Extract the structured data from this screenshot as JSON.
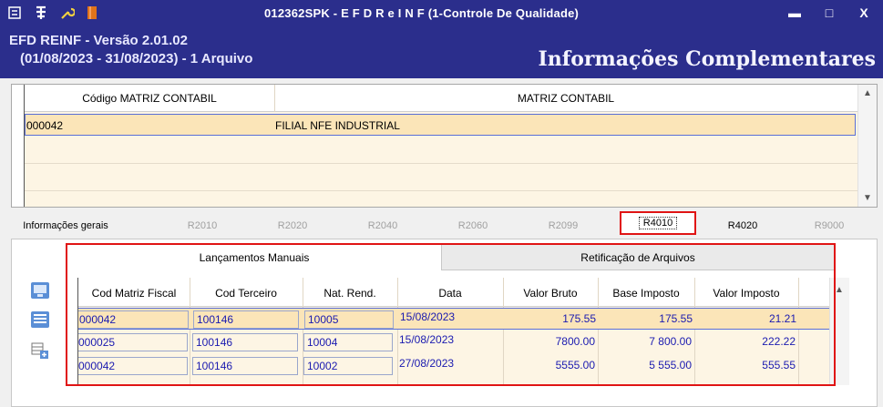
{
  "window": {
    "title": "012362SPK - E F D  R e I N F (1-Controle De Qualidade)",
    "minimize": "▬",
    "maximize": "□",
    "close": "X"
  },
  "header": {
    "version": "EFD REINF - Versão 2.01.02",
    "period": "(01/08/2023 - 31/08/2023) - 1 Arquivo",
    "page_title": "Informações Complementares"
  },
  "matriz_grid": {
    "columns": [
      "Código MATRIZ CONTABIL",
      "MATRIZ CONTABIL"
    ],
    "rows": [
      {
        "codigo": "000042",
        "matriz": "FILIAL NFE INDUSTRIAL"
      }
    ]
  },
  "tabs": [
    "Informações gerais",
    "R2010",
    "R2020",
    "R2040",
    "R2060",
    "R2099",
    "R4010",
    "R4020",
    "R9000"
  ],
  "subtabs": [
    "Lançamentos Manuais",
    "Retificação de Arquivos"
  ],
  "lanc_grid": {
    "columns": [
      "Cod Matriz Fiscal",
      "Cod Terceiro",
      "Nat. Rend.",
      "Data",
      "Valor Bruto",
      "Base Imposto",
      "Valor Imposto"
    ],
    "rows": [
      {
        "cod_matriz": "000042",
        "cod_terceiro": "100146",
        "nat_rend": "10005",
        "data": "15/08/2023",
        "valor_bruto": "175.55",
        "base_imposto": "175.55",
        "valor_imposto": "21.21"
      },
      {
        "cod_matriz": "000025",
        "cod_terceiro": "100146",
        "nat_rend": "10004",
        "data": "15/08/2023",
        "valor_bruto": "7800.00",
        "base_imposto": "7 800.00",
        "valor_imposto": "222.22"
      },
      {
        "cod_matriz": "000042",
        "cod_terceiro": "100146",
        "nat_rend": "10002",
        "data": "27/08/2023",
        "valor_bruto": "5555.00",
        "base_imposto": "5 555.00",
        "valor_imposto": "555.55"
      }
    ]
  },
  "colors": {
    "titlebar": "#2b2e8c",
    "highlight": "#e01414",
    "row_selected": "#fbe5b8",
    "grid_bg": "#fdf5e4",
    "value_text": "#1a1ab0"
  },
  "icons": {
    "titlebar": [
      "menu-icon",
      "tree-icon",
      "wrench-icon",
      "book-icon"
    ],
    "side": [
      "monitor-icon",
      "monitor-list-icon",
      "add-grid-icon"
    ]
  }
}
